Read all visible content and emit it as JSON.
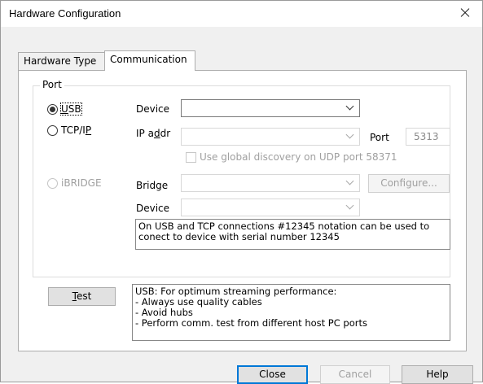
{
  "window": {
    "title": "Hardware Configuration"
  },
  "tabs": [
    {
      "label": "Hardware Type",
      "active": false
    },
    {
      "label": "Communication",
      "active": true
    }
  ],
  "port_group": {
    "label": "Port",
    "radios": [
      {
        "label_pre": "",
        "label_u": "U",
        "label_post": "SB",
        "selected": true,
        "enabled": true
      },
      {
        "label_pre": "TCP/I",
        "label_u": "P",
        "label_post": "",
        "selected": false,
        "enabled": true
      },
      {
        "label_pre": "iBRIDGE",
        "label_u": "",
        "label_post": "",
        "selected": false,
        "enabled": false
      }
    ],
    "usb_device_label": "Device",
    "usb_device_value": "",
    "ip_label_pre": "IP a",
    "ip_label_u": "d",
    "ip_label_post": "dr",
    "ip_value": "",
    "port_label": "Port",
    "port_value": "5313",
    "global_discovery_label": "Use global discovery on UDP port 58371",
    "global_discovery_checked": false,
    "bridge_label": "Bridge",
    "bridge_value": "",
    "configure_button": "Configure...",
    "bridge_device_label": "Device",
    "bridge_device_value": "",
    "note": "On USB and TCP connections #12345 notation can be used to\nconect to device with serial number 12345"
  },
  "test_button": {
    "label_u": "T",
    "label_post": "est"
  },
  "tips": "USB: For optimum streaming performance:\n - Always use quality cables\n - Avoid hubs\n - Perform comm. test from different host PC ports",
  "footer": {
    "close": "Close",
    "cancel": "Cancel",
    "help": "Help"
  }
}
